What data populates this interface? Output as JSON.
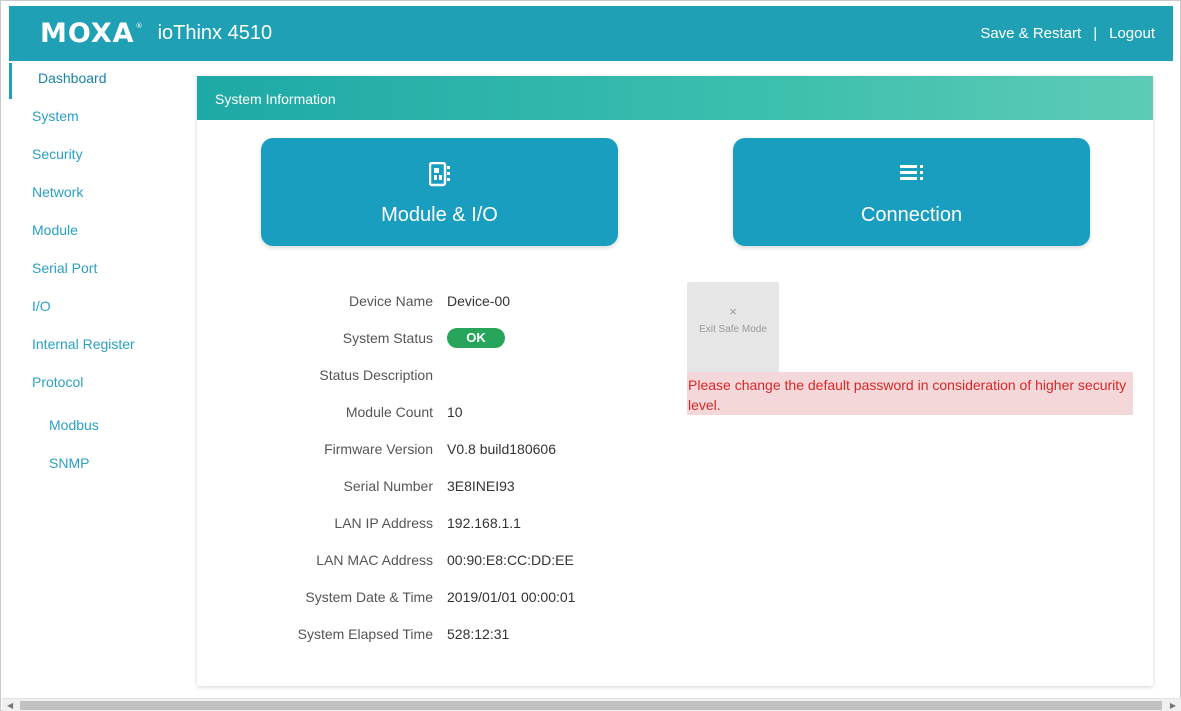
{
  "header": {
    "brand": "MOXA",
    "brand_mark": "®",
    "product": "ioThinx 4510",
    "save_restart": "Save & Restart",
    "separator": "|",
    "logout": "Logout"
  },
  "sidebar": {
    "items": [
      {
        "label": "Dashboard"
      },
      {
        "label": "System"
      },
      {
        "label": "Security"
      },
      {
        "label": "Network"
      },
      {
        "label": "Module"
      },
      {
        "label": "Serial Port"
      },
      {
        "label": "I/O"
      },
      {
        "label": "Internal Register"
      },
      {
        "label": "Protocol",
        "toggle": "-"
      },
      {
        "label": "Modbus"
      },
      {
        "label": "SNMP"
      }
    ]
  },
  "main": {
    "section_title": "System Information",
    "tiles": {
      "module": {
        "label": "Module & I/O",
        "icon": "module-chip-icon"
      },
      "connection": {
        "label": "Connection",
        "icon": "list-icon"
      }
    },
    "info": {
      "device_name": {
        "label": "Device Name",
        "value": "Device-00"
      },
      "system_status": {
        "label": "System Status",
        "value": "OK"
      },
      "status_description": {
        "label": "Status Description",
        "value": ""
      },
      "module_count": {
        "label": "Module Count",
        "value": "10"
      },
      "firmware_version": {
        "label": "Firmware Version",
        "value": "V0.8 build180606"
      },
      "serial_number": {
        "label": "Serial Number",
        "value": "3E8INEI93"
      },
      "lan_ip": {
        "label": "LAN IP Address",
        "value": "192.168.1.1"
      },
      "lan_mac": {
        "label": "LAN MAC Address",
        "value": "00:90:E8:CC:DD:EE"
      },
      "date_time": {
        "label": "System Date & Time",
        "value": "2019/01/01 00:00:01"
      },
      "elapsed": {
        "label": "System Elapsed Time",
        "value": "528:12:31"
      }
    },
    "safe_mode": {
      "icon": "×",
      "label": "Exit Safe Mode"
    },
    "warning": "Please change the default password in consideration of higher security level."
  },
  "colors": {
    "header": "#1fa0b5",
    "tile": "#1a9ec0",
    "status_ok": "#27a55a",
    "warning_bg": "#f3d7d9",
    "warning_text": "#d92727",
    "sidebar_link": "#2aa0c4"
  }
}
